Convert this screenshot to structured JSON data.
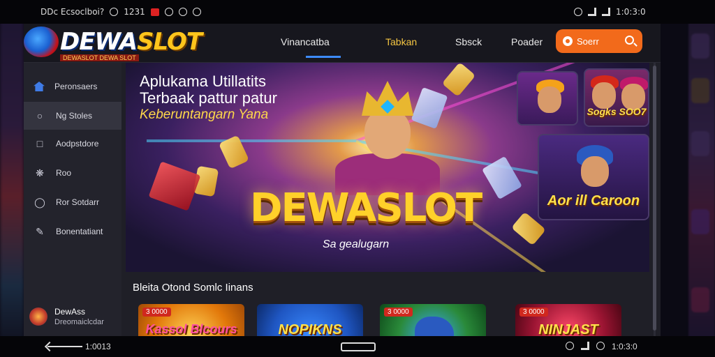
{
  "status_bar": {
    "left_text": "DDc Ecsoclboi?",
    "left_time": "1231",
    "right_text": "1:0:3:0"
  },
  "header": {
    "logo_main": "DEWA",
    "logo_accent": "SLOT",
    "logo_tagline": "DEWASLOT DEWA SLOT",
    "nav": [
      "Vinancatba",
      "Tabkan",
      "Sbsck",
      "Poader"
    ],
    "search_label": "Soerr"
  },
  "sidebar": {
    "items": [
      {
        "label": "Peronsaers",
        "icon": "home-icon"
      },
      {
        "label": "Ng Stoles",
        "icon": "search-icon"
      },
      {
        "label": "Aodpstdore",
        "icon": "store-icon"
      },
      {
        "label": "Roo",
        "icon": "settings-icon"
      },
      {
        "label": "Ror Sotdarr",
        "icon": "globe-icon"
      },
      {
        "label": "Bonentatiant",
        "icon": "pen-icon"
      }
    ],
    "user_name": "DewAss",
    "user_sub": "Dreomaiclcdar"
  },
  "hero": {
    "line1": "Aplukama Utillatits",
    "line2": "Terbaak pattur patur",
    "line3": "Keberuntangarn Yana",
    "title": "DEWASLOT",
    "subtitle": "Sa gealugarn"
  },
  "side_tiles": [
    {
      "label": "Aor ill Caroon"
    },
    {
      "label": "Sogks SOO7"
    }
  ],
  "section_title": "Bleita Otond Somlc Iinans",
  "games": [
    {
      "badge": "3 0000",
      "name": "Kassol Blcours",
      "color": "#f2a21a"
    },
    {
      "badge": "",
      "name": "NOPIKNS",
      "color": "#1f56c2"
    },
    {
      "badge": "3 0000",
      "name": "",
      "color": "#2a8a3a"
    },
    {
      "badge": "3 0000",
      "name": "NINJAST",
      "color": "#9a1432"
    }
  ],
  "bottom_bar": {
    "left_text": "1:0013",
    "right_text": "1:0:3:0"
  },
  "colors": {
    "accent": "#f26a1b",
    "gold": "#ffd12a",
    "nav_underline": "#3d8bff"
  }
}
